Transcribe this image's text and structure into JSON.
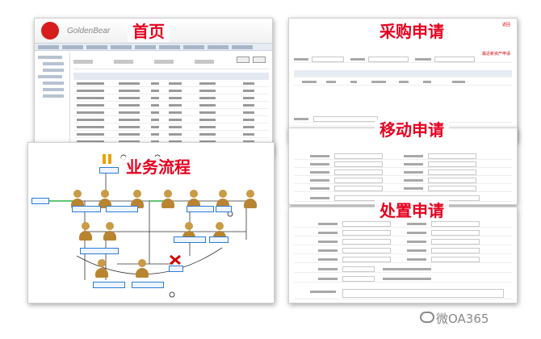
{
  "captions": {
    "home": "首页",
    "flow": "业务流程",
    "purchase": "采购申请",
    "mobile": "移动申请",
    "dispose": "处置申请"
  },
  "home": {
    "brand": "GoldenBear"
  },
  "purchase": {
    "top_links": "返回",
    "warn": "最近新资产申请"
  },
  "watermark": "微OA365",
  "colors": {
    "caption_red": "#e5001f",
    "flow_blue": "#2b7bd9"
  }
}
